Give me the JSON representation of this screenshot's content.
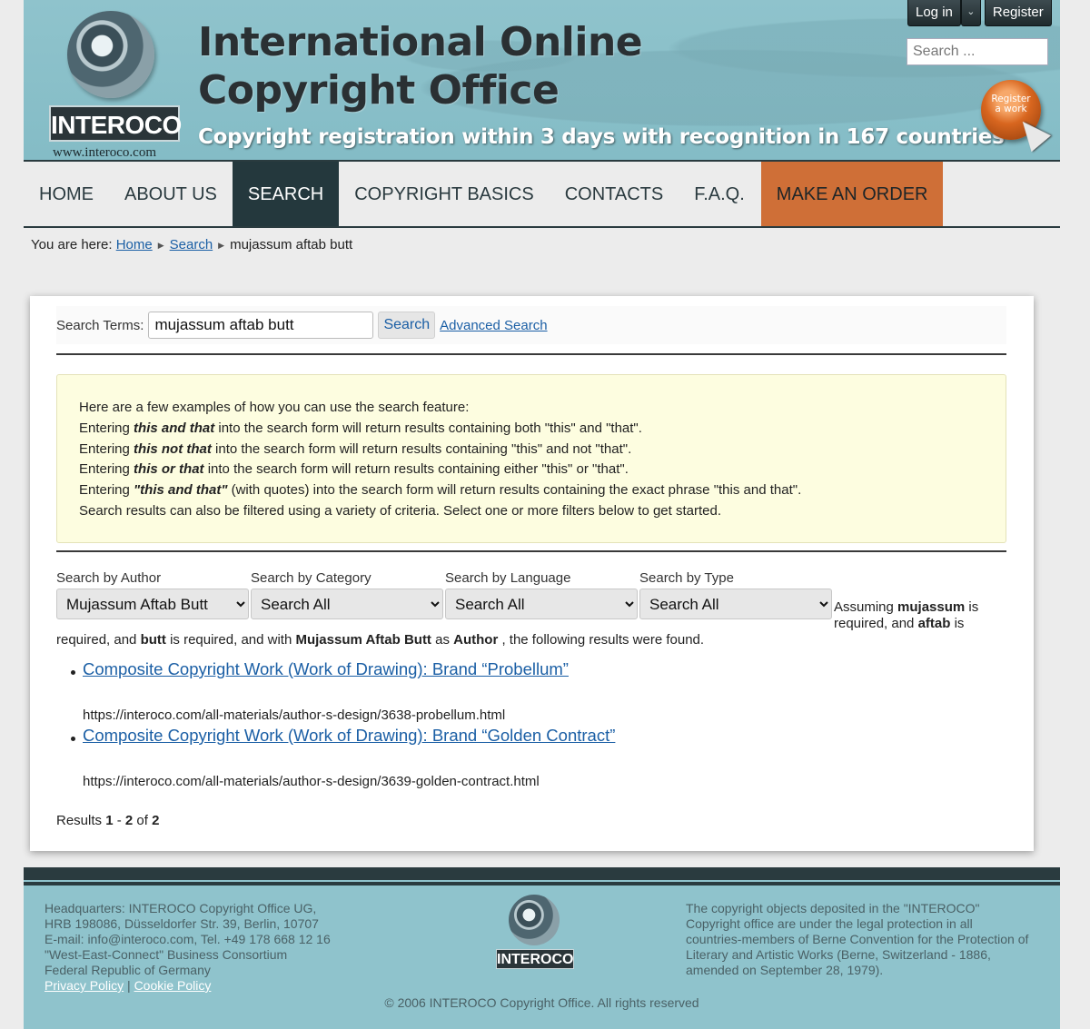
{
  "header": {
    "logo_text": "INTEROCO",
    "logo_url": "www.interoco.com",
    "title_line1": "International Online",
    "title_line2": "Copyright Office",
    "tagline": "Copyright registration within 3 days with recognition in 167 countries",
    "login_label": "Log in",
    "register_label": "Register",
    "search_placeholder": "Search ...",
    "register_work_line1": "Register",
    "register_work_line2": "a work"
  },
  "nav": {
    "items": [
      {
        "label": "HOME"
      },
      {
        "label": "ABOUT US"
      },
      {
        "label": "SEARCH"
      },
      {
        "label": "COPYRIGHT BASICS"
      },
      {
        "label": "CONTACTS"
      },
      {
        "label": "F.A.Q."
      },
      {
        "label": "MAKE AN ORDER"
      }
    ],
    "active": "SEARCH"
  },
  "breadcrumb": {
    "prefix": "You are here:",
    "home": "Home",
    "search": "Search",
    "current": "mujassum aftab butt"
  },
  "search": {
    "terms_label": "Search Terms:",
    "terms_value": "mujassum aftab butt",
    "button_label": "Search",
    "advanced_label": "Advanced Search"
  },
  "examples": {
    "intro": "Here are a few examples of how you can use the search feature:",
    "e1_pre": "Entering ",
    "e1_em": "this and that",
    "e1_post": " into the search form will return results containing both \"this\" and \"that\".",
    "e2_pre": "Entering ",
    "e2_em": "this not that",
    "e2_post": " into the search form will return results containing \"this\" and not \"that\".",
    "e3_pre": "Entering ",
    "e3_em": "this or that",
    "e3_post": " into the search form will return results containing either \"this\" or \"that\".",
    "e4_pre": "Entering ",
    "e4_em": "\"this and that\"",
    "e4_post": " (with quotes) into the search form will return results containing the exact phrase \"this and that\".",
    "outro": "Search results can also be filtered using a variety of criteria. Select one or more filters below to get started."
  },
  "filters": {
    "author_label": "Search by Author",
    "author_value": "Mujassum Aftab Butt",
    "category_label": "Search by Category",
    "category_value": "Search All",
    "language_label": "Search by Language",
    "language_value": "Search All",
    "type_label": "Search by Type",
    "type_value": "Search All"
  },
  "assumption": {
    "w1": "Assuming ",
    "t1": "mujassum",
    "w2": " is required, and ",
    "t2": "aftab",
    "w3": " is",
    "w4": "required, and ",
    "t3": "butt",
    "w5": " is required, and with ",
    "t4": "Mujassum Aftab Butt",
    "w6": " as ",
    "t5": "Author",
    "w7": " , the following results were found."
  },
  "results": [
    {
      "title": "Composite Copyright Work (Work of Drawing): Brand “Probellum”",
      "url": "https://interoco.com/all-materials/author-s-design/3638-probellum.html"
    },
    {
      "title": "Composite Copyright Work (Work of Drawing): Brand “Golden Contract”",
      "url": "https://interoco.com/all-materials/author-s-design/3639-golden-contract.html"
    }
  ],
  "counter": {
    "prefix": "Results ",
    "from": "1",
    "dash": " - ",
    "to": "2",
    "of": " of ",
    "total": "2"
  },
  "footer": {
    "left_lines": [
      "Headquarters: INTEROCO Copyright Office UG,",
      "HRB 198086, Düsseldorfer Str. 39, Berlin, 10707",
      "E-mail: info@interoco.com, Tel. +49 178 668 12 16",
      "\"West-East-Connect\" Business Consortium",
      "Federal Republic of Germany"
    ],
    "privacy_label": "Privacy Policy",
    "cookie_label": "Cookie Policy",
    "logo_text": "INTEROCO",
    "right_text": "The copyright objects deposited in the \"INTEROCO\" Copyright office are under the legal protection in all countries-members of Berne Convention for the Protection of Literary and Artistic Works (Berne, Switzerland - 1886, amended on September 28, 1979).",
    "copyright": "© 2006 INTEROCO Copyright Office. All rights reserved"
  }
}
